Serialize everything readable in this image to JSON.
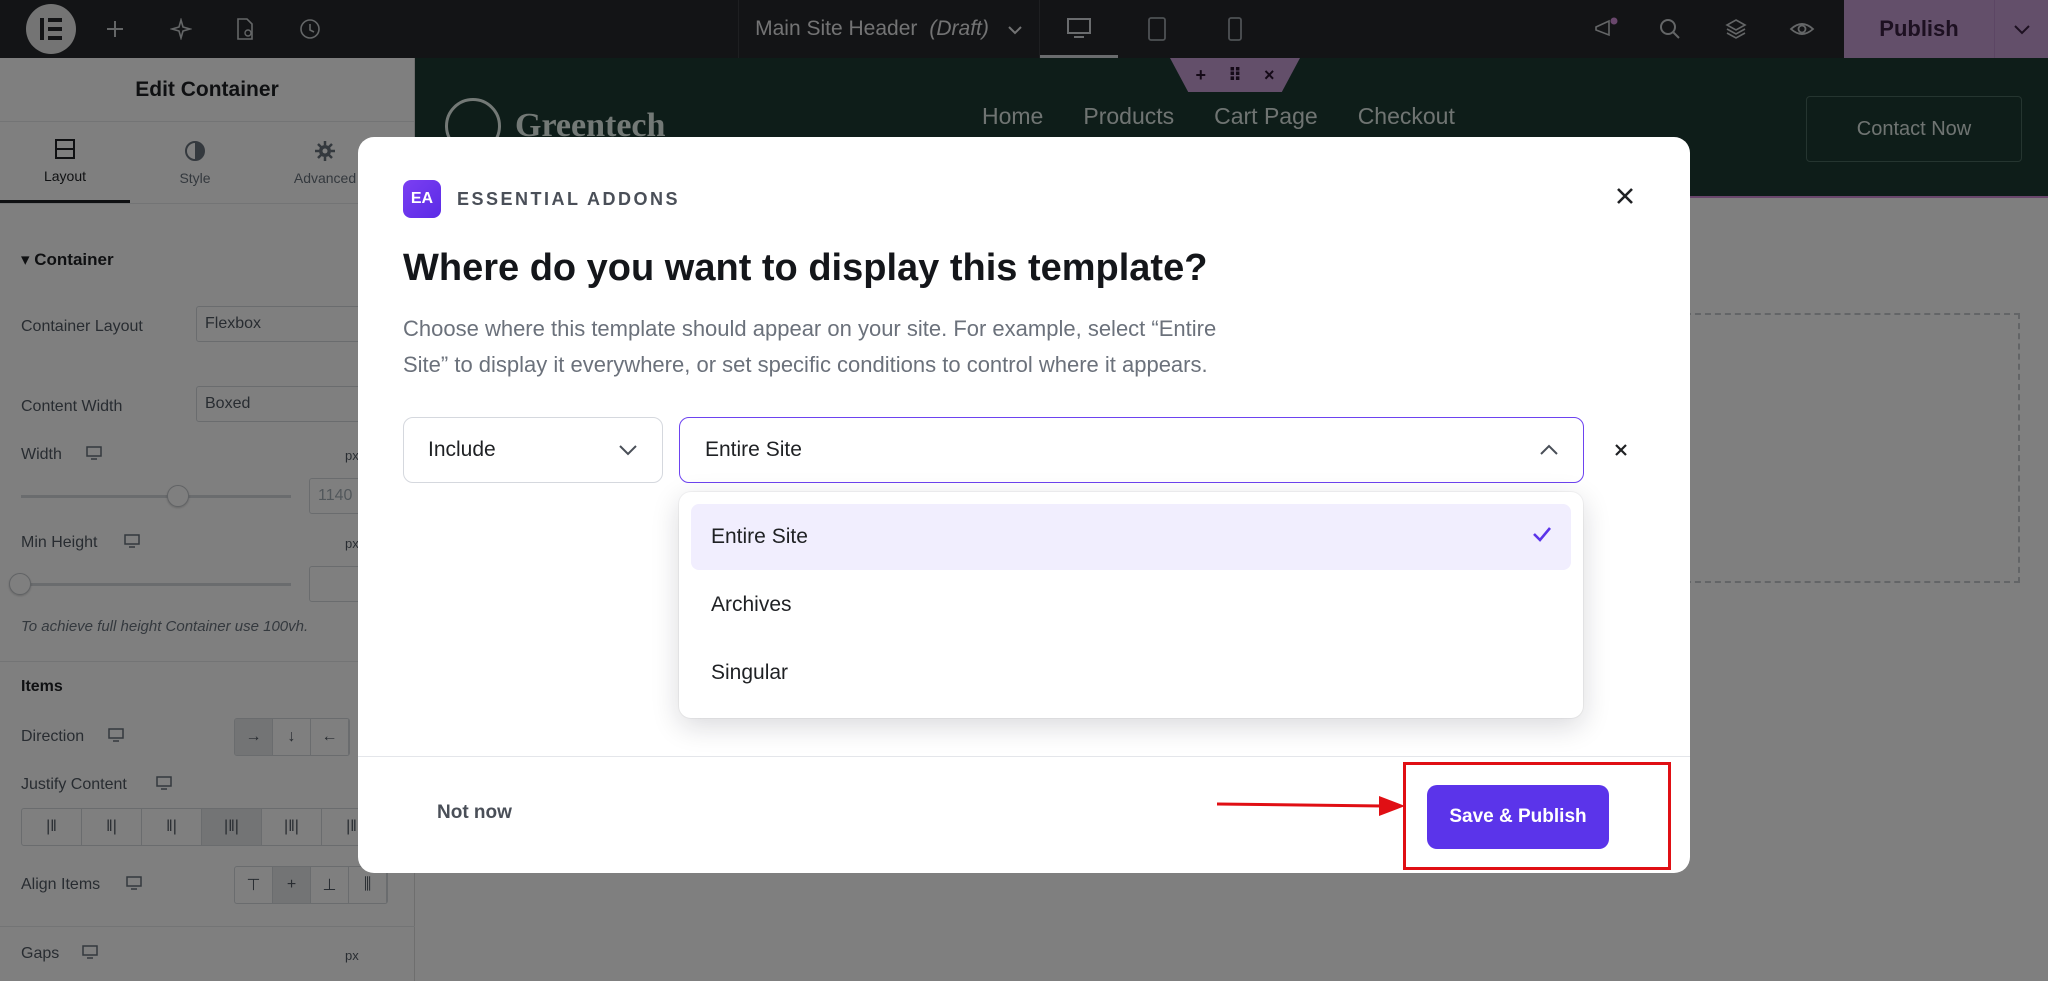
{
  "topbar": {
    "document_title": "Main Site Header",
    "document_status": "(Draft)",
    "publish_label": "Publish",
    "icons": [
      "elementor-logo-icon",
      "plus-icon",
      "sparkle-icon",
      "page-settings-icon",
      "history-icon",
      "desktop-icon",
      "tablet-icon",
      "mobile-icon",
      "announcement-icon",
      "search-icon",
      "layers-icon",
      "preview-eye-icon",
      "chevron-down-icon"
    ]
  },
  "panel": {
    "title": "Edit Container",
    "tabs": [
      {
        "label": "Layout",
        "icon": "layout-icon"
      },
      {
        "label": "Style",
        "icon": "style-half-circle-icon"
      },
      {
        "label": "Advanced",
        "icon": "gear-icon"
      }
    ],
    "section_container": "Container",
    "container_layout_label": "Container Layout",
    "container_layout_value": "Flexbox",
    "content_width_label": "Content Width",
    "content_width_value": "Boxed",
    "width_label": "Width",
    "width_unit": "px",
    "width_value": "1140",
    "min_height_label": "Min Height",
    "min_height_unit": "px",
    "min_height_note": "To achieve full height Container use 100vh.",
    "section_items": "Items",
    "direction_label": "Direction",
    "justify_content_label": "Justify Content",
    "align_items_label": "Align Items",
    "gaps_label": "Gaps",
    "gaps_unit": "px"
  },
  "canvas": {
    "logo_text": "Greentech",
    "nav": [
      "Home",
      "Products",
      "Cart Page",
      "Checkout"
    ],
    "contact_label": "Contact Now"
  },
  "modal": {
    "brand": "ESSENTIAL ADDONS",
    "brand_icon_text": "EA",
    "title": "Where do you want to display this template?",
    "description_line1": "Choose where this template should appear on your site. For example, select “Entire",
    "description_line2": "Site” to display it everywhere, or set specific conditions to control where it appears.",
    "include_value": "Include",
    "location_value": "Entire Site",
    "options": [
      "Entire Site",
      "Archives",
      "Singular"
    ],
    "selected_option": "Entire Site",
    "not_now_label": "Not now",
    "save_label": "Save & Publish"
  },
  "colors": {
    "accent": "#5b34ea",
    "annotation": "#e00f14",
    "publish_bg": "#c79ed5"
  }
}
